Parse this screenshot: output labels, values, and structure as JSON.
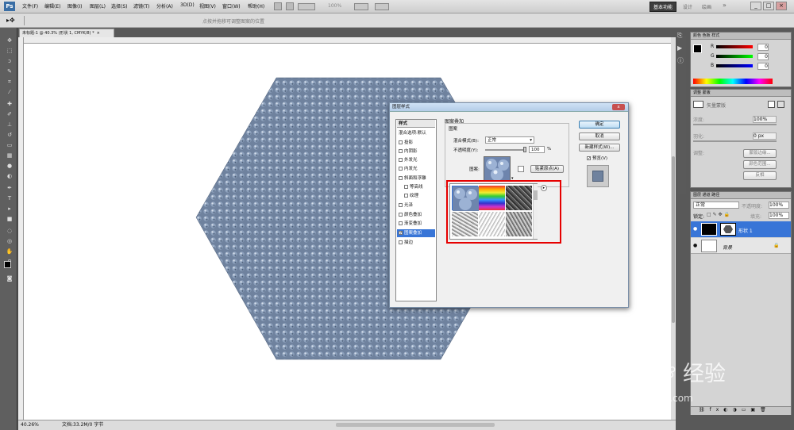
{
  "app": {
    "logo": "Ps",
    "menus": [
      "文件(F)",
      "编辑(E)",
      "图像(I)",
      "图层(L)",
      "选择(S)",
      "滤镜(T)",
      "分析(A)",
      "3D(D)",
      "视图(V)",
      "窗口(W)",
      "帮助(H)"
    ],
    "zoom_display": "100%",
    "workspaces": [
      "基本功能",
      "设计",
      "绘画"
    ],
    "win": [
      "_",
      "□",
      "×"
    ]
  },
  "options": {
    "hint": "点按并拖移可调整图案的位置"
  },
  "document": {
    "tab_title": "未标题-1 @ 40.3% (形状 1, CMYK/8) *",
    "tab_close": "×"
  },
  "status": {
    "zoom": "40.26%",
    "doc_size": "文档:33.2M/0 字节"
  },
  "colors": {
    "hexagon": "#6f829e",
    "highlight": "#e60000",
    "titlebar": "#c2d6ee"
  },
  "right_panels": {
    "color_tabs": [
      "颜色",
      "色板",
      "样式"
    ],
    "rgb": [
      {
        "ch": "R",
        "val": "0"
      },
      {
        "ch": "G",
        "val": "0"
      },
      {
        "ch": "B",
        "val": "0"
      }
    ],
    "adj_tabs": [
      "调整",
      "蒙版"
    ],
    "mask_label": "矢量蒙版",
    "density_label": "浓度:",
    "density": "100%",
    "feather_label": "羽化:",
    "feather": "0 px",
    "refine_label": "调整:",
    "edge_btn": "蒙版边缘...",
    "range_btn": "颜色范围...",
    "invert_btn": "反相",
    "layers_tabs": [
      "图层",
      "通道",
      "路径"
    ],
    "blend": "正常",
    "opacity_label": "不透明度:",
    "opacity": "100%",
    "lock_label": "锁定:",
    "fill_label": "填充:",
    "fill": "100%",
    "layers": [
      {
        "name": "形状 1"
      },
      {
        "name": "背景"
      }
    ]
  },
  "dialog": {
    "title": "图层样式",
    "close": "x",
    "styles_header": "样式",
    "blend_default": "混合选项:默认",
    "items": [
      {
        "label": "投影",
        "checked": false
      },
      {
        "label": "内阴影",
        "checked": false
      },
      {
        "label": "外发光",
        "checked": false
      },
      {
        "label": "内发光",
        "checked": false
      },
      {
        "label": "斜面和浮雕",
        "checked": false
      },
      {
        "label": "等高线",
        "checked": false
      },
      {
        "label": "纹理",
        "checked": false
      },
      {
        "label": "光泽",
        "checked": false
      },
      {
        "label": "颜色叠加",
        "checked": false
      },
      {
        "label": "渐变叠加",
        "checked": false
      },
      {
        "label": "图案叠加",
        "checked": true
      },
      {
        "label": "描边",
        "checked": false
      }
    ],
    "section": "图案叠加",
    "subsection": "图案",
    "blend_mode_label": "混合模式(B):",
    "blend_mode": "正常",
    "opacity_label": "不透明度(Y):",
    "opacity": "100",
    "pct": "%",
    "pattern_label": "图案:",
    "snap_btn": "贴紧原点(A)",
    "ok": "确定",
    "cancel": "取消",
    "new_style": "新建样式(W)...",
    "preview": "预览(V)"
  },
  "watermark": {
    "brand": "Bai",
    "brand2": "经验",
    "url": "jingyan.baidu.com"
  }
}
